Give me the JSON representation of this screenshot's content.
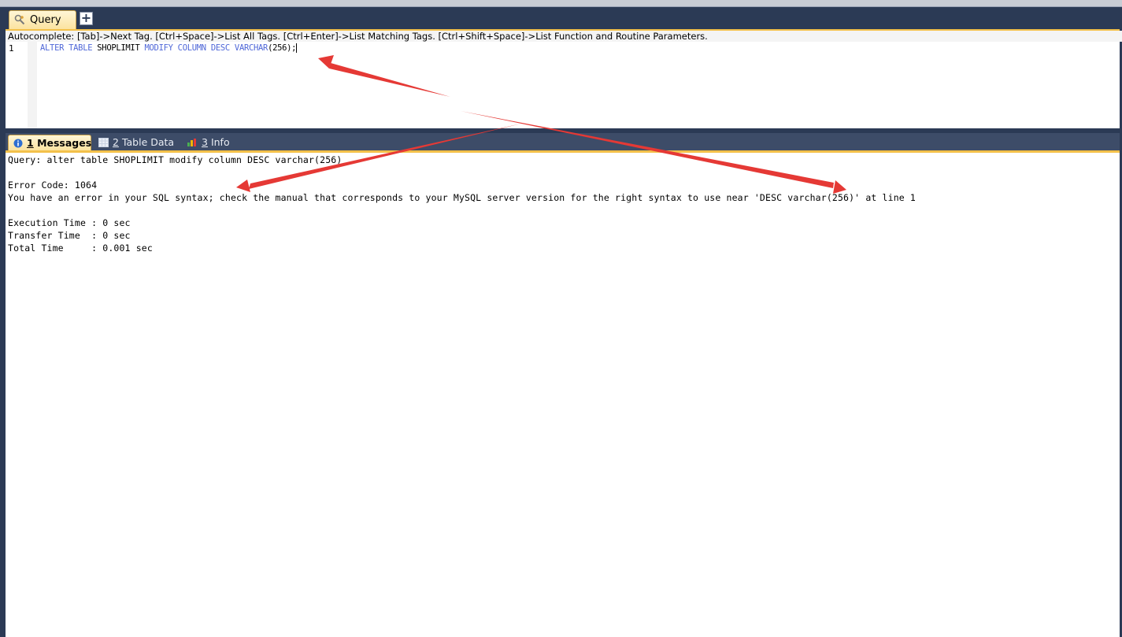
{
  "query_tab": {
    "label": "Query",
    "icon": "query-wrench-icon"
  },
  "add_tab": {
    "label": "+"
  },
  "autocomplete_hint": "Autocomplete: [Tab]->Next Tag. [Ctrl+Space]->List All Tags. [Ctrl+Enter]->List Matching Tags. [Ctrl+Shift+Space]->List Function and Routine Parameters.",
  "editor": {
    "line_number": "1",
    "tokens": {
      "alter_table": "ALTER TABLE",
      "table_name": "SHOPLIMIT",
      "modify_column_desc_varchar": "MODIFY COLUMN DESC VARCHAR",
      "args": "(256);"
    }
  },
  "result_tabs": [
    {
      "num": "1",
      "label": "Messages",
      "icon": "info-icon",
      "active": true
    },
    {
      "num": "2",
      "label": "Table Data",
      "icon": "table-grid-icon",
      "active": false
    },
    {
      "num": "3",
      "label": "Info",
      "icon": "info-chart-icon",
      "active": false
    }
  ],
  "messages": {
    "query_line": "Query: alter table SHOPLIMIT modify column DESC varchar(256)",
    "error_code": "Error Code: 1064",
    "error_message": "You have an error in your SQL syntax; check the manual that corresponds to your MySQL server version for the right syntax to use near 'DESC varchar(256)' at line 1",
    "execution_time": "Execution Time : 0 sec",
    "transfer_time": "Transfer Time  : 0 sec",
    "total_time": "Total Time     : 0.001 sec"
  },
  "colors": {
    "frame": "#2b3a55",
    "tab_accent": "#f3c14a",
    "keyword": "#5068d8",
    "annotation_arrow": "#e53935"
  }
}
